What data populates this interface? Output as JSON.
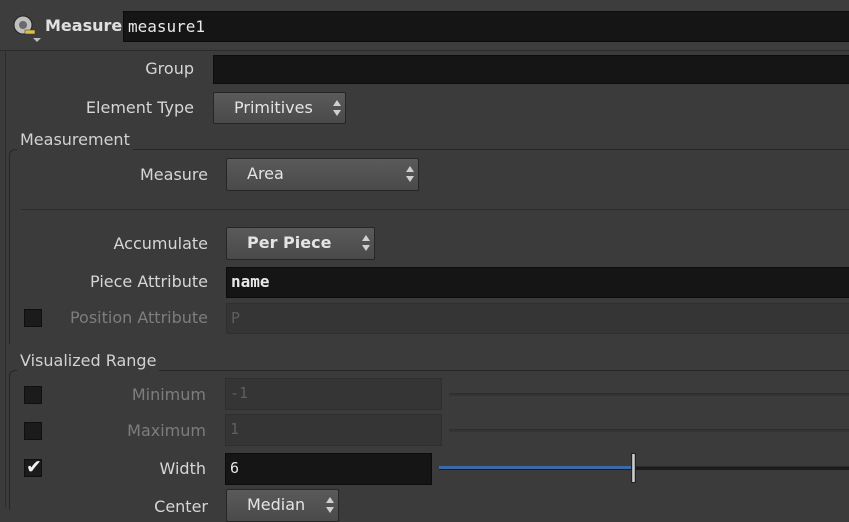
{
  "header": {
    "node_type": "Measure",
    "node_name": "measure1"
  },
  "fields": {
    "group": {
      "label": "Group",
      "value": ""
    },
    "element_type": {
      "label": "Element Type",
      "value": "Primitives"
    }
  },
  "measurement": {
    "title": "Measurement",
    "measure": {
      "label": "Measure",
      "value": "Area"
    },
    "accumulate": {
      "label": "Accumulate",
      "value": "Per Piece"
    },
    "piece_attribute": {
      "label": "Piece Attribute",
      "value": "name"
    },
    "position_attribute": {
      "label": "Position Attribute",
      "value": "P",
      "enabled": false
    }
  },
  "visualized_range": {
    "title": "Visualized Range",
    "minimum": {
      "label": "Minimum",
      "value": "-1",
      "enabled": false
    },
    "maximum": {
      "label": "Maximum",
      "value": "1",
      "enabled": false
    },
    "width": {
      "label": "Width",
      "value": "6",
      "enabled": true,
      "slider_fraction": 0.47
    },
    "center": {
      "label": "Center",
      "value": "Median"
    }
  },
  "colors": {
    "background": "#3b3b3b",
    "field": "#151515",
    "slider_fill": "#3a6aa8"
  },
  "icons": [
    "measure-tape-icon",
    "dropdown-arrows-icon",
    "checkmark-icon"
  ]
}
